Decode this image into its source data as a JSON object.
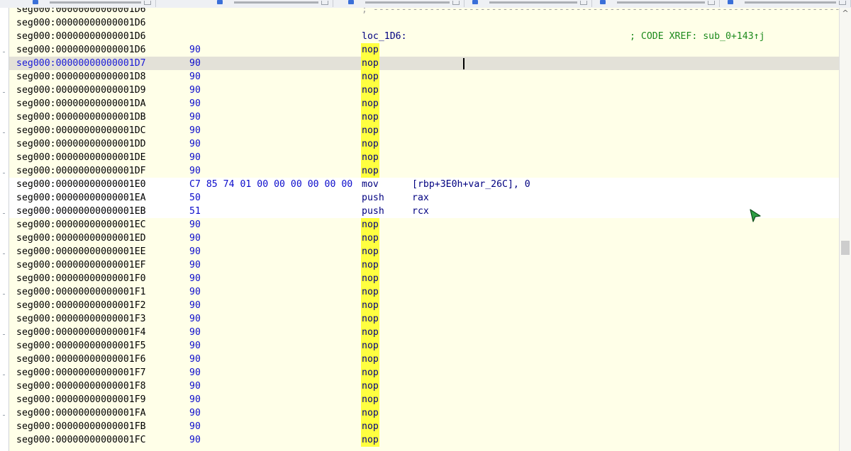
{
  "tabs": [
    {
      "label": ""
    },
    {
      "label": ""
    },
    {
      "label": ""
    },
    {
      "label": ""
    },
    {
      "label": ""
    },
    {
      "label": ""
    },
    {
      "label": ""
    }
  ],
  "listing": {
    "separator_text": "; -------------------------------------------------------------------------------------",
    "label_text": "loc_1D6:",
    "xref_comment": "; CODE XREF: sub_0+143↑j",
    "rows": [
      {
        "addr": "seg000:00000000000001D6",
        "bytes": "",
        "mnem": "",
        "ops": "",
        "kind": "sep"
      },
      {
        "addr": "seg000:00000000000001D6",
        "bytes": "",
        "mnem": "",
        "ops": "",
        "kind": "blank"
      },
      {
        "addr": "seg000:00000000000001D6",
        "bytes": "",
        "mnem": "",
        "ops": "",
        "kind": "label"
      },
      {
        "addr": "seg000:00000000000001D6",
        "bytes": "90",
        "mnem": "nop",
        "ops": "",
        "kind": "nop"
      },
      {
        "addr": "seg000:00000000000001D7",
        "bytes": "90",
        "mnem": "nop",
        "ops": "",
        "kind": "nop-current"
      },
      {
        "addr": "seg000:00000000000001D8",
        "bytes": "90",
        "mnem": "nop",
        "ops": "",
        "kind": "nop"
      },
      {
        "addr": "seg000:00000000000001D9",
        "bytes": "90",
        "mnem": "nop",
        "ops": "",
        "kind": "nop"
      },
      {
        "addr": "seg000:00000000000001DA",
        "bytes": "90",
        "mnem": "nop",
        "ops": "",
        "kind": "nop"
      },
      {
        "addr": "seg000:00000000000001DB",
        "bytes": "90",
        "mnem": "nop",
        "ops": "",
        "kind": "nop"
      },
      {
        "addr": "seg000:00000000000001DC",
        "bytes": "90",
        "mnem": "nop",
        "ops": "",
        "kind": "nop"
      },
      {
        "addr": "seg000:00000000000001DD",
        "bytes": "90",
        "mnem": "nop",
        "ops": "",
        "kind": "nop"
      },
      {
        "addr": "seg000:00000000000001DE",
        "bytes": "90",
        "mnem": "nop",
        "ops": "",
        "kind": "nop"
      },
      {
        "addr": "seg000:00000000000001DF",
        "bytes": "90",
        "mnem": "nop",
        "ops": "",
        "kind": "nop"
      },
      {
        "addr": "seg000:00000000000001E0",
        "bytes": "C7 85 74 01 00 00 00 00 00 00",
        "mnem": "mov",
        "ops": "[rbp+3E0h+var_26C], 0",
        "kind": "code"
      },
      {
        "addr": "seg000:00000000000001EA",
        "bytes": "50",
        "mnem": "push",
        "ops": "rax",
        "kind": "code"
      },
      {
        "addr": "seg000:00000000000001EB",
        "bytes": "51",
        "mnem": "push",
        "ops": "rcx",
        "kind": "code"
      },
      {
        "addr": "seg000:00000000000001EC",
        "bytes": "90",
        "mnem": "nop",
        "ops": "",
        "kind": "nop"
      },
      {
        "addr": "seg000:00000000000001ED",
        "bytes": "90",
        "mnem": "nop",
        "ops": "",
        "kind": "nop"
      },
      {
        "addr": "seg000:00000000000001EE",
        "bytes": "90",
        "mnem": "nop",
        "ops": "",
        "kind": "nop"
      },
      {
        "addr": "seg000:00000000000001EF",
        "bytes": "90",
        "mnem": "nop",
        "ops": "",
        "kind": "nop"
      },
      {
        "addr": "seg000:00000000000001F0",
        "bytes": "90",
        "mnem": "nop",
        "ops": "",
        "kind": "nop"
      },
      {
        "addr": "seg000:00000000000001F1",
        "bytes": "90",
        "mnem": "nop",
        "ops": "",
        "kind": "nop"
      },
      {
        "addr": "seg000:00000000000001F2",
        "bytes": "90",
        "mnem": "nop",
        "ops": "",
        "kind": "nop"
      },
      {
        "addr": "seg000:00000000000001F3",
        "bytes": "90",
        "mnem": "nop",
        "ops": "",
        "kind": "nop"
      },
      {
        "addr": "seg000:00000000000001F4",
        "bytes": "90",
        "mnem": "nop",
        "ops": "",
        "kind": "nop"
      },
      {
        "addr": "seg000:00000000000001F5",
        "bytes": "90",
        "mnem": "nop",
        "ops": "",
        "kind": "nop"
      },
      {
        "addr": "seg000:00000000000001F6",
        "bytes": "90",
        "mnem": "nop",
        "ops": "",
        "kind": "nop"
      },
      {
        "addr": "seg000:00000000000001F7",
        "bytes": "90",
        "mnem": "nop",
        "ops": "",
        "kind": "nop"
      },
      {
        "addr": "seg000:00000000000001F8",
        "bytes": "90",
        "mnem": "nop",
        "ops": "",
        "kind": "nop"
      },
      {
        "addr": "seg000:00000000000001F9",
        "bytes": "90",
        "mnem": "nop",
        "ops": "",
        "kind": "nop"
      },
      {
        "addr": "seg000:00000000000001FA",
        "bytes": "90",
        "mnem": "nop",
        "ops": "",
        "kind": "nop"
      },
      {
        "addr": "seg000:00000000000001FB",
        "bytes": "90",
        "mnem": "nop",
        "ops": "",
        "kind": "nop"
      },
      {
        "addr": "seg000:00000000000001FC",
        "bytes": "90",
        "mnem": "nop",
        "ops": "",
        "kind": "nop"
      }
    ]
  },
  "scrollbar": {
    "up_arrow": "^"
  },
  "icons": {
    "tab_icon": "document-icon",
    "tab_close": "close-icon",
    "cursor": "mouse-cursor-icon"
  },
  "colors": {
    "listing_background": "#ffffe8",
    "code_background": "#ffffff",
    "nop_highlight": "#ffff40",
    "comment": "#1c8a1c",
    "bytes": "#0c0ccc"
  }
}
